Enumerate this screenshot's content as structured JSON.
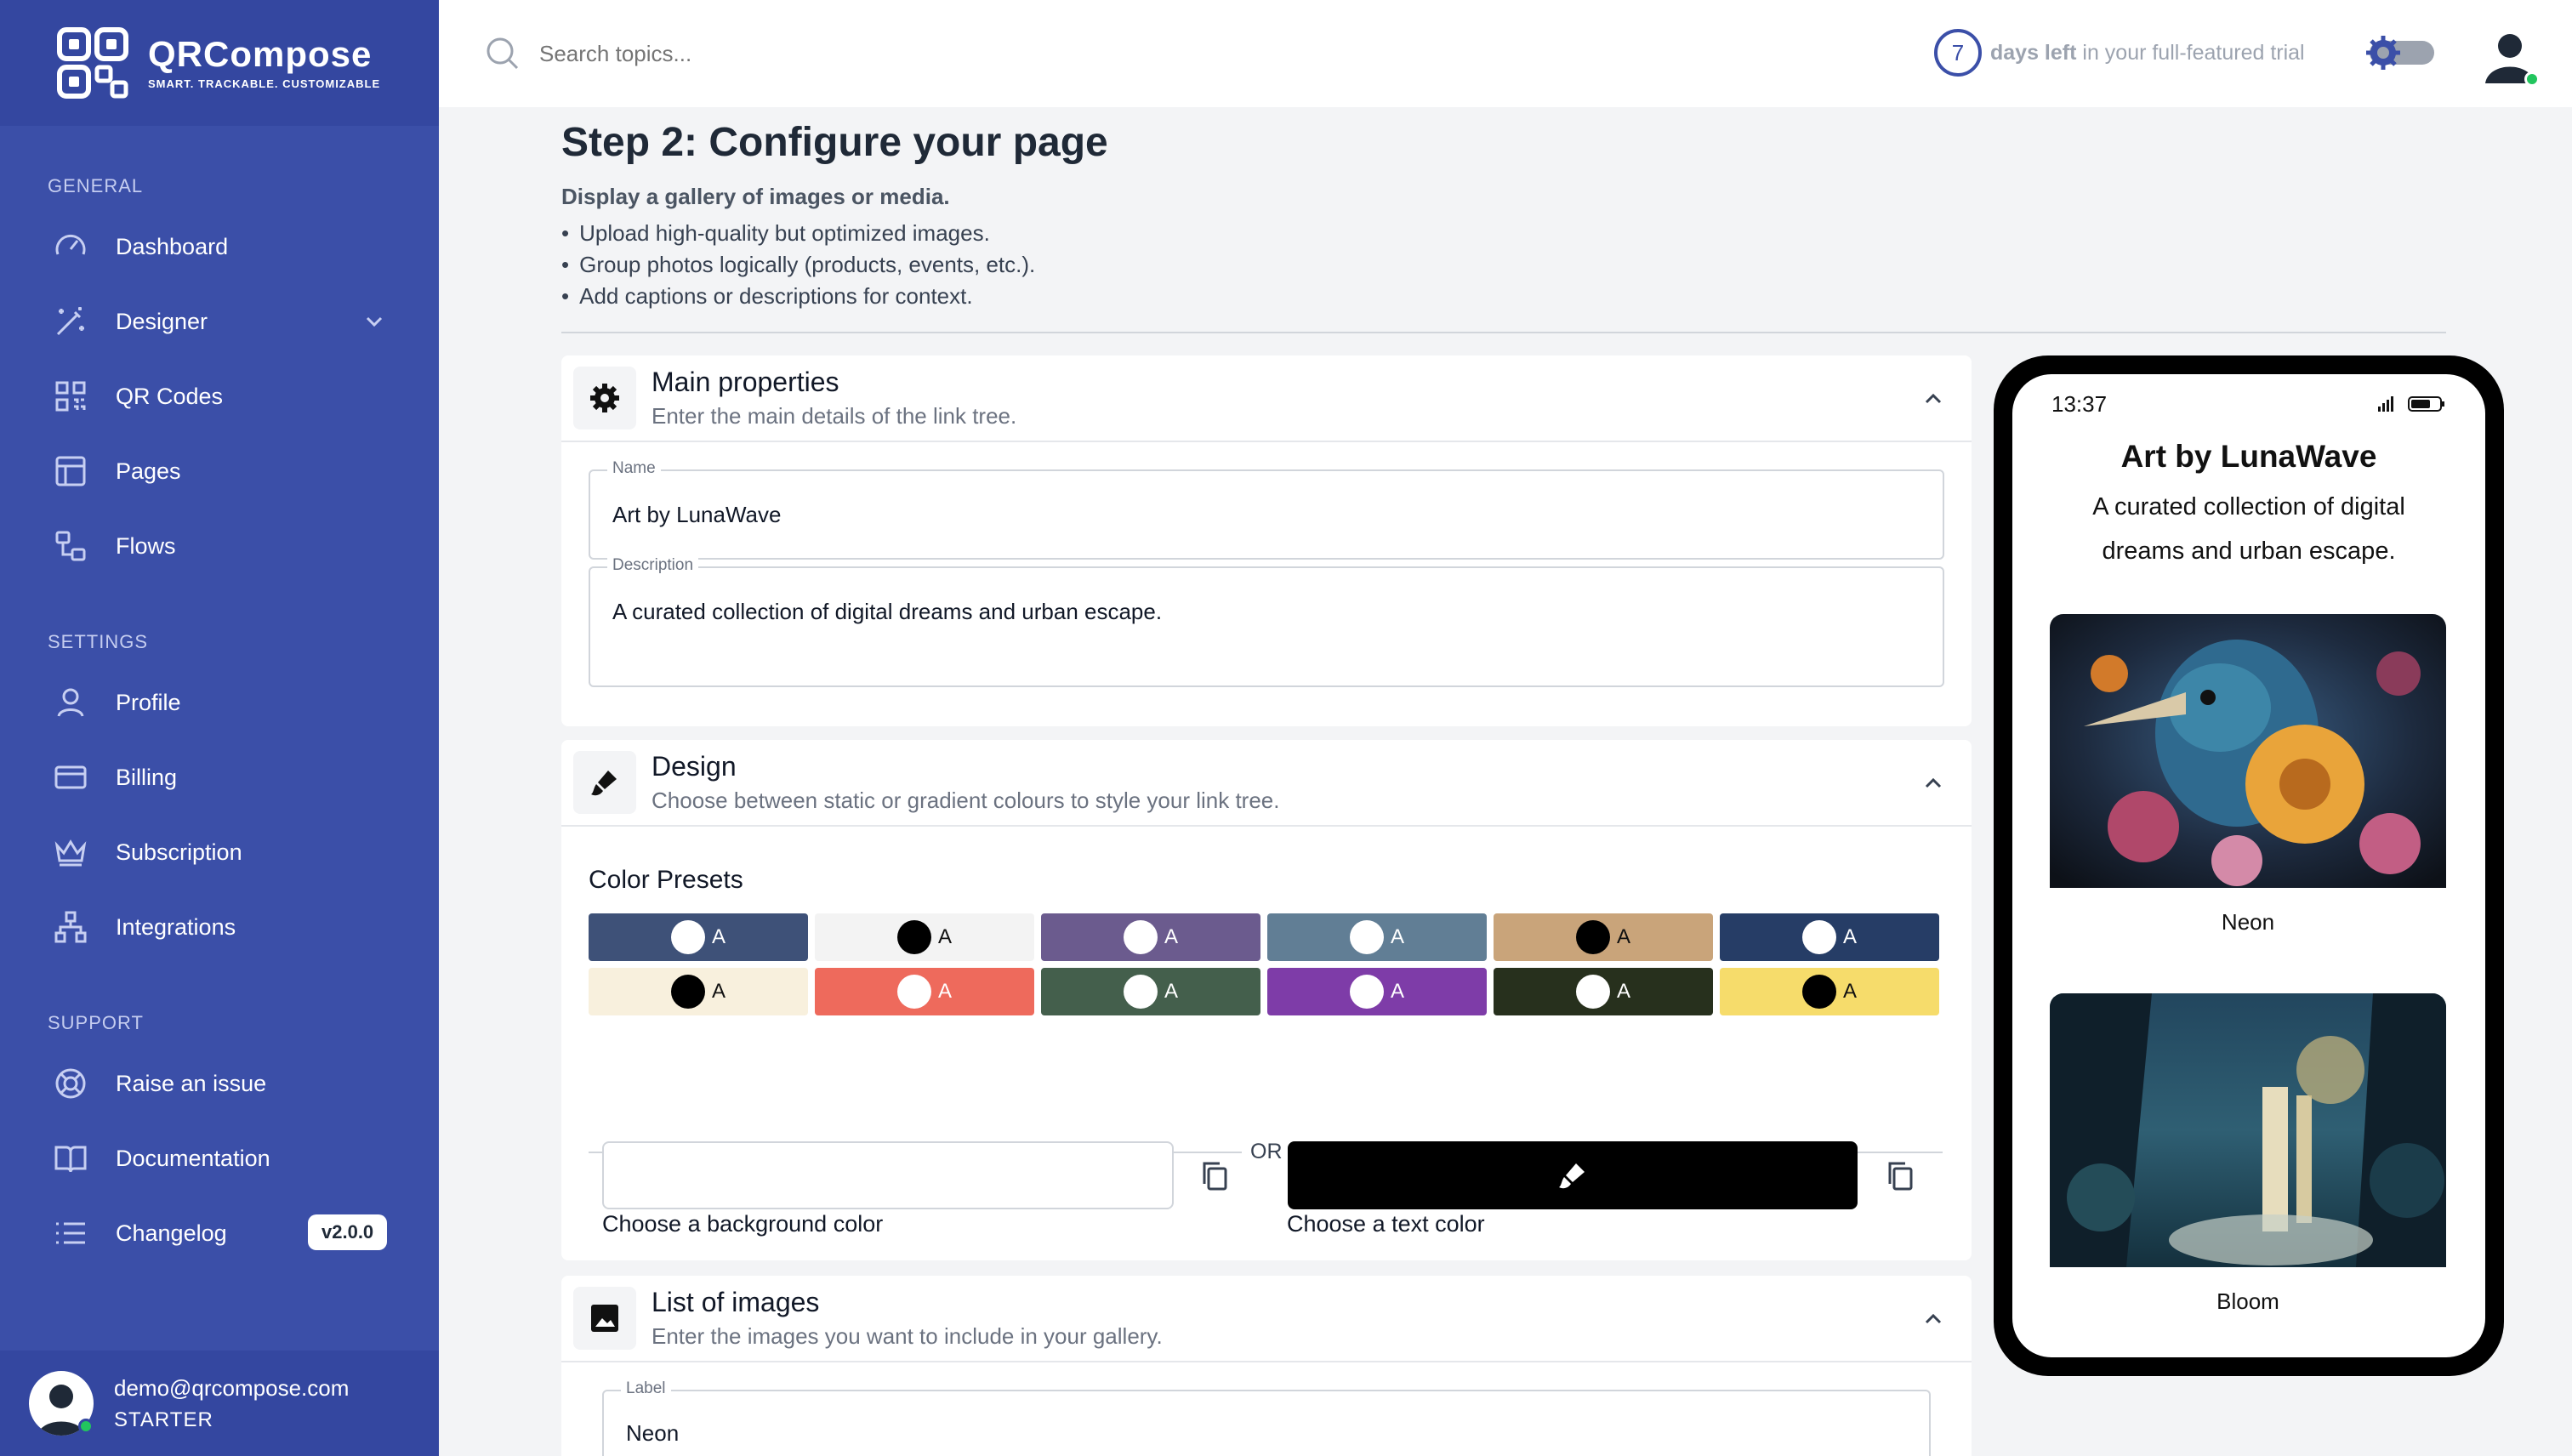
{
  "brand": {
    "name": "QRCompose",
    "tagline": "SMART. TRACKABLE. CUSTOMIZABLE"
  },
  "sidebar": {
    "sections": [
      {
        "title": "GENERAL"
      },
      {
        "title": "SETTINGS"
      },
      {
        "title": "SUPPORT"
      }
    ],
    "items": [
      {
        "label": "Dashboard",
        "icon": "gauge-icon"
      },
      {
        "label": "Designer",
        "icon": "magic-wand-icon"
      },
      {
        "label": "QR Codes",
        "icon": "qr-icon"
      },
      {
        "label": "Pages",
        "icon": "layout-icon"
      },
      {
        "label": "Flows",
        "icon": "flow-icon"
      },
      {
        "label": "Profile",
        "icon": "user-icon"
      },
      {
        "label": "Billing",
        "icon": "credit-card-icon"
      },
      {
        "label": "Subscription",
        "icon": "crown-icon"
      },
      {
        "label": "Integrations",
        "icon": "network-icon"
      },
      {
        "label": "Raise an issue",
        "icon": "lifebuoy-icon"
      },
      {
        "label": "Documentation",
        "icon": "book-icon"
      },
      {
        "label": "Changelog",
        "icon": "list-icon",
        "badge": "v2.0.0"
      }
    ],
    "user": {
      "email": "demo@qrcompose.com",
      "plan": "STARTER"
    }
  },
  "topbar": {
    "search_placeholder": "Search topics...",
    "trial_days": "7",
    "trial_bold": "days left",
    "trial_rest": " in your full-featured trial"
  },
  "page": {
    "title": "Step 2: Configure your page",
    "subtitle": "Display a gallery of images or media.",
    "tips": [
      "Upload high-quality but optimized images.",
      "Group photos logically (products, events, etc.).",
      "Add captions or descriptions for context."
    ]
  },
  "main_properties": {
    "title": "Main properties",
    "desc": "Enter the main details of the link tree.",
    "name_label": "Name",
    "name_value": "Art by LunaWave",
    "description_label": "Description",
    "description_value": "A curated collection of digital dreams and urban escape."
  },
  "design": {
    "title": "Design",
    "desc": "Choose between static or gradient colours to style your link tree.",
    "presets_label": "Color Presets",
    "preset_letter": "A",
    "presets": [
      {
        "bg": "#3e5178",
        "dot": "#ffffff",
        "text": "#ffffff"
      },
      {
        "bg": "#f3f3f3",
        "dot": "#000000",
        "text": "#111111"
      },
      {
        "bg": "#6b5b8e",
        "dot": "#ffffff",
        "text": "#ffffff"
      },
      {
        "bg": "#617e95",
        "dot": "#ffffff",
        "text": "#ffffff"
      },
      {
        "bg": "#c9a47a",
        "dot": "#000000",
        "text": "#111111"
      },
      {
        "bg": "#263d66",
        "dot": "#ffffff",
        "text": "#ffffff"
      },
      {
        "bg": "#f8f0dd",
        "dot": "#000000",
        "text": "#111111"
      },
      {
        "bg": "#ee6a5c",
        "dot": "#ffffff",
        "text": "#ffffff"
      },
      {
        "bg": "#445f4c",
        "dot": "#ffffff",
        "text": "#ffffff"
      },
      {
        "bg": "#7e3ca8",
        "dot": "#ffffff",
        "text": "#ffffff"
      },
      {
        "bg": "#27301d",
        "dot": "#ffffff",
        "text": "#ffffff"
      },
      {
        "bg": "#f6dc6b",
        "dot": "#000000",
        "text": "#111111"
      }
    ],
    "or_text": "OR",
    "bg_label": "Choose a background color",
    "bg_value": "#ffffff",
    "text_label": "Choose a text color",
    "text_value": "#000000"
  },
  "images": {
    "title": "List of images",
    "desc": "Enter the images you want to include in your gallery.",
    "label_field": "Label",
    "label_value": "Neon"
  },
  "preview": {
    "time": "13:37",
    "title": "Art by LunaWave",
    "desc": "A curated collection of digital dreams and urban escape.",
    "cards": [
      {
        "caption": "Neon"
      },
      {
        "caption": "Bloom"
      }
    ]
  },
  "colors": {
    "sidebar": "#3b4fa8",
    "accent": "#3b4fa8",
    "online": "#22c55e"
  }
}
